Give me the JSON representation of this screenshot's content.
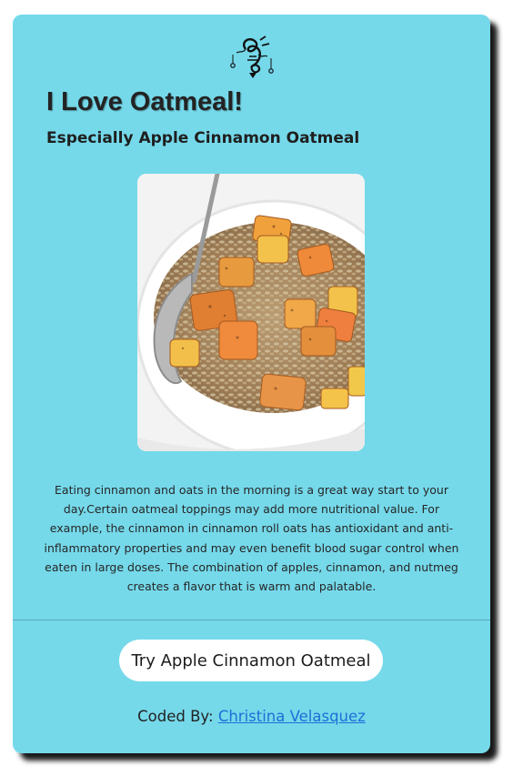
{
  "page": {
    "title": "I Love Oatmeal!",
    "subtitle": "Especially Apple Cinnamon Oatmeal",
    "logo_icon": "calligraphy-logo-icon",
    "image_icon": "apple-cinnamon-oatmeal-bowl-photo",
    "description": "Eating cinnamon and oats in the morning is a great way start to your day.Certain oatmeal toppings may add more nutritional value. For example, the cinnamon in cinnamon roll oats has antioxidant and anti-inflammatory properties and may even benefit blood sugar control when eaten in large doses. The combination of apples, cinnamon, and nutmeg creates a flavor that is warm and palatable.",
    "button_label": "Try Apple Cinnamon Oatmeal",
    "credit_prefix": "Coded By: ",
    "credit_name": "Christina Velasquez"
  },
  "colors": {
    "card_background": "#75d9ea",
    "link": "#1f6fd6",
    "button_background": "#ffffff"
  }
}
